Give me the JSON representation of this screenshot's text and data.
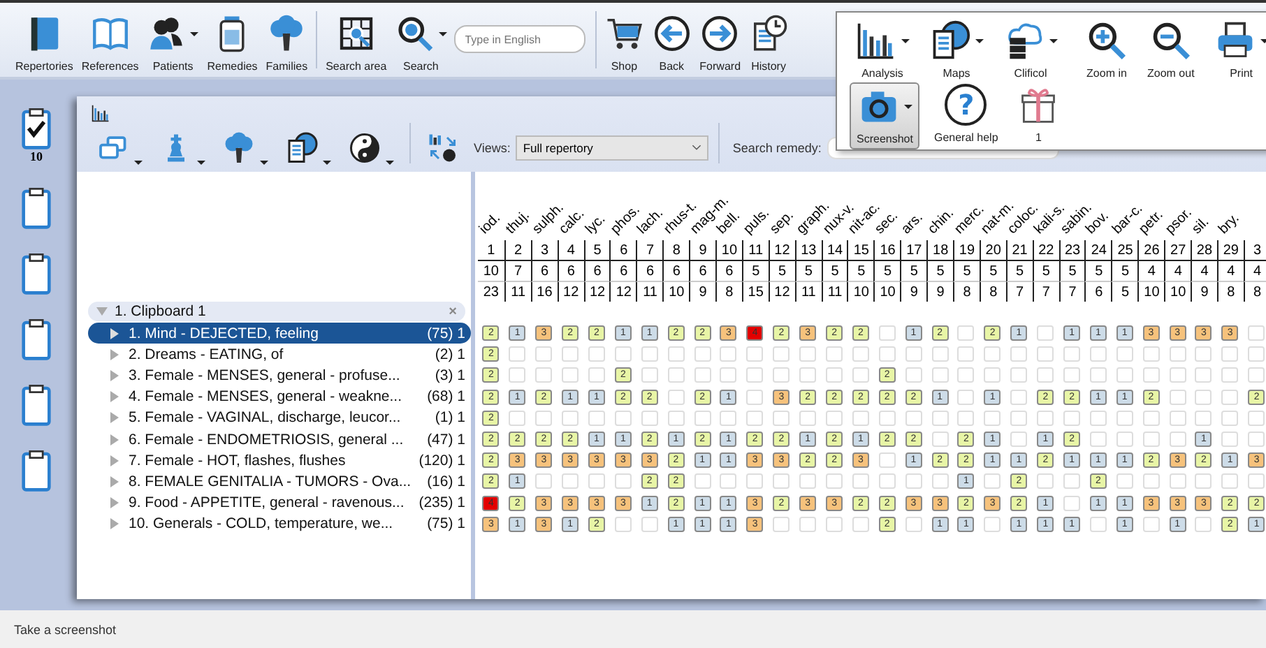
{
  "toolbar": [
    {
      "label": "Repertories",
      "dropdown": false
    },
    {
      "label": "References",
      "dropdown": false
    },
    {
      "label": "Patients",
      "dropdown": true
    },
    {
      "label": "Remedies",
      "dropdown": false
    },
    {
      "label": "Families",
      "dropdown": false
    },
    {
      "label": "Search area",
      "dropdown": false
    },
    {
      "label": "Search",
      "dropdown": true
    },
    {
      "label": "Shop",
      "dropdown": false
    },
    {
      "label": "Back",
      "dropdown": false
    },
    {
      "label": "Forward",
      "dropdown": false
    },
    {
      "label": "History",
      "dropdown": false
    }
  ],
  "search_field": {
    "placeholder": "Type in English"
  },
  "ribbon_menu": {
    "row_1": [
      {
        "label": "Analysis",
        "dropdown": true
      },
      {
        "label": "Maps",
        "dropdown": true
      },
      {
        "label": "Clificol",
        "dropdown": true
      },
      {
        "label": "Zoom in",
        "dropdown": false
      },
      {
        "label": "Zoom out",
        "dropdown": false
      },
      {
        "label": "Print",
        "dropdown": true
      }
    ],
    "row_2": [
      {
        "label": "Screenshot",
        "dropdown": true,
        "selected": true
      },
      {
        "label": "General help",
        "dropdown": false,
        "selected": false,
        "glyph": "?"
      },
      {
        "label": "1",
        "dropdown": false,
        "selected": false
      }
    ]
  },
  "clipboards": [
    {
      "checked": true,
      "count": "10"
    },
    {
      "checked": false
    },
    {
      "checked": false
    },
    {
      "checked": false
    },
    {
      "checked": false
    },
    {
      "checked": false
    }
  ],
  "panel_toolbar": [
    {
      "dropdown": true
    },
    {
      "dropdown": true
    },
    {
      "dropdown": true
    },
    {
      "dropdown": true
    },
    {
      "dropdown": true
    },
    {
      "dropdown": false
    }
  ],
  "views": {
    "label": "Views:",
    "value": "Full repertory"
  },
  "search_remedy": {
    "label": "Search remedy:"
  },
  "remedies": [
    {
      "name": "iod.",
      "number": "1",
      "count": "10",
      "total": "23"
    },
    {
      "name": "thuj.",
      "number": "2",
      "count": "7",
      "total": "11"
    },
    {
      "name": "sulph.",
      "number": "3",
      "count": "6",
      "total": "16"
    },
    {
      "name": "calc.",
      "number": "4",
      "count": "6",
      "total": "12"
    },
    {
      "name": "lyc.",
      "number": "5",
      "count": "6",
      "total": "12"
    },
    {
      "name": "phos.",
      "number": "6",
      "count": "6",
      "total": "12"
    },
    {
      "name": "lach.",
      "number": "7",
      "count": "6",
      "total": "11"
    },
    {
      "name": "rhus-t.",
      "number": "8",
      "count": "6",
      "total": "10"
    },
    {
      "name": "mag-m.",
      "number": "9",
      "count": "6",
      "total": "9"
    },
    {
      "name": "bell.",
      "number": "10",
      "count": "6",
      "total": "8"
    },
    {
      "name": "puls.",
      "number": "11",
      "count": "5",
      "total": "15"
    },
    {
      "name": "sep.",
      "number": "12",
      "count": "5",
      "total": "12"
    },
    {
      "name": "graph.",
      "number": "13",
      "count": "5",
      "total": "11"
    },
    {
      "name": "nux-v.",
      "number": "14",
      "count": "5",
      "total": "11"
    },
    {
      "name": "nit-ac.",
      "number": "15",
      "count": "5",
      "total": "10"
    },
    {
      "name": "sec.",
      "number": "16",
      "count": "5",
      "total": "10"
    },
    {
      "name": "ars.",
      "number": "17",
      "count": "5",
      "total": "9"
    },
    {
      "name": "chin.",
      "number": "18",
      "count": "5",
      "total": "9"
    },
    {
      "name": "merc.",
      "number": "19",
      "count": "5",
      "total": "8"
    },
    {
      "name": "nat-m.",
      "number": "20",
      "count": "5",
      "total": "8"
    },
    {
      "name": "coloc.",
      "number": "21",
      "count": "5",
      "total": "7"
    },
    {
      "name": "kali-s.",
      "number": "22",
      "count": "5",
      "total": "7"
    },
    {
      "name": "sabin.",
      "number": "23",
      "count": "5",
      "total": "7"
    },
    {
      "name": "bov.",
      "number": "24",
      "count": "5",
      "total": "6"
    },
    {
      "name": "bar-c.",
      "number": "25",
      "count": "5",
      "total": "5"
    },
    {
      "name": "petr.",
      "number": "26",
      "count": "4",
      "total": "10"
    },
    {
      "name": "psor.",
      "number": "27",
      "count": "4",
      "total": "10"
    },
    {
      "name": "sil.",
      "number": "28",
      "count": "4",
      "total": "9"
    },
    {
      "name": "bry.",
      "number": "29",
      "count": "4",
      "total": "8"
    },
    {
      "number": "3",
      "count": "4",
      "total": "8"
    }
  ],
  "clipboard": {
    "title": "1. Clipboard 1",
    "expanded": true,
    "close": "×"
  },
  "rubrics": [
    {
      "label": "1. Mind - DEJECTED, feeling",
      "count": "(75) 1",
      "selected": true,
      "cells": [
        {
          "filled": true,
          "grade": "2"
        },
        {
          "filled": true,
          "grade": "1"
        },
        {
          "filled": true,
          "grade": "3"
        },
        {
          "filled": true,
          "grade": "2"
        },
        {
          "filled": true,
          "grade": "2"
        },
        {
          "filled": true,
          "grade": "1"
        },
        {
          "filled": true,
          "grade": "1"
        },
        {
          "filled": true,
          "grade": "2"
        },
        {
          "filled": true,
          "grade": "2"
        },
        {
          "filled": true,
          "grade": "3"
        },
        {
          "filled": true,
          "grade": "4"
        },
        {
          "filled": true,
          "grade": "2"
        },
        {
          "filled": true,
          "grade": "3"
        },
        {
          "filled": true,
          "grade": "2"
        },
        {
          "filled": true,
          "grade": "2"
        },
        {
          "filled": false
        },
        {
          "filled": true,
          "grade": "1"
        },
        {
          "filled": true,
          "grade": "2"
        },
        {
          "filled": false
        },
        {
          "filled": true,
          "grade": "2"
        },
        {
          "filled": true,
          "grade": "1"
        },
        {
          "filled": false
        },
        {
          "filled": true,
          "grade": "1"
        },
        {
          "filled": true,
          "grade": "1"
        },
        {
          "filled": true,
          "grade": "1"
        },
        {
          "filled": true,
          "grade": "3"
        },
        {
          "filled": true,
          "grade": "3"
        },
        {
          "filled": true,
          "grade": "3"
        },
        {
          "filled": true,
          "grade": "3"
        },
        {
          "filled": false
        }
      ]
    },
    {
      "label": "2. Dreams - EATING, of",
      "count": "(2) 1",
      "selected": false,
      "cells": [
        {
          "filled": true,
          "grade": "2"
        },
        {
          "filled": false
        },
        {
          "filled": false
        },
        {
          "filled": false
        },
        {
          "filled": false
        },
        {
          "filled": false
        },
        {
          "filled": false
        },
        {
          "filled": false
        },
        {
          "filled": false
        },
        {
          "filled": false
        },
        {
          "filled": false
        },
        {
          "filled": false
        },
        {
          "filled": false
        },
        {
          "filled": false
        },
        {
          "filled": false
        },
        {
          "filled": false
        },
        {
          "filled": false
        },
        {
          "filled": false
        },
        {
          "filled": false
        },
        {
          "filled": false
        },
        {
          "filled": false
        },
        {
          "filled": false
        },
        {
          "filled": false
        },
        {
          "filled": false
        },
        {
          "filled": false
        },
        {
          "filled": false
        },
        {
          "filled": false
        },
        {
          "filled": false
        },
        {
          "filled": false
        },
        {
          "filled": false
        }
      ]
    },
    {
      "label": "3. Female - MENSES, general - profuse...",
      "count": "(3) 1",
      "selected": false,
      "cells": [
        {
          "filled": true,
          "grade": "2"
        },
        {
          "filled": false
        },
        {
          "filled": false
        },
        {
          "filled": false
        },
        {
          "filled": false
        },
        {
          "filled": true,
          "grade": "2"
        },
        {
          "filled": false
        },
        {
          "filled": false
        },
        {
          "filled": false
        },
        {
          "filled": false
        },
        {
          "filled": false
        },
        {
          "filled": false
        },
        {
          "filled": false
        },
        {
          "filled": false
        },
        {
          "filled": false
        },
        {
          "filled": true,
          "grade": "2"
        },
        {
          "filled": false
        },
        {
          "filled": false
        },
        {
          "filled": false
        },
        {
          "filled": false
        },
        {
          "filled": false
        },
        {
          "filled": false
        },
        {
          "filled": false
        },
        {
          "filled": false
        },
        {
          "filled": false
        },
        {
          "filled": false
        },
        {
          "filled": false
        },
        {
          "filled": false
        },
        {
          "filled": false
        },
        {
          "filled": false
        }
      ]
    },
    {
      "label": "4. Female - MENSES, general - weakne...",
      "count": "(68) 1",
      "selected": false,
      "cells": [
        {
          "filled": true,
          "grade": "2"
        },
        {
          "filled": true,
          "grade": "1"
        },
        {
          "filled": true,
          "grade": "2"
        },
        {
          "filled": true,
          "grade": "1"
        },
        {
          "filled": true,
          "grade": "1"
        },
        {
          "filled": true,
          "grade": "2"
        },
        {
          "filled": true,
          "grade": "2"
        },
        {
          "filled": false
        },
        {
          "filled": true,
          "grade": "2"
        },
        {
          "filled": true,
          "grade": "1"
        },
        {
          "filled": false
        },
        {
          "filled": true,
          "grade": "3"
        },
        {
          "filled": true,
          "grade": "2"
        },
        {
          "filled": true,
          "grade": "2"
        },
        {
          "filled": true,
          "grade": "2"
        },
        {
          "filled": true,
          "grade": "2"
        },
        {
          "filled": true,
          "grade": "2"
        },
        {
          "filled": true,
          "grade": "1"
        },
        {
          "filled": false
        },
        {
          "filled": true,
          "grade": "1"
        },
        {
          "filled": false
        },
        {
          "filled": true,
          "grade": "2"
        },
        {
          "filled": true,
          "grade": "2"
        },
        {
          "filled": true,
          "grade": "1"
        },
        {
          "filled": true,
          "grade": "1"
        },
        {
          "filled": true,
          "grade": "2"
        },
        {
          "filled": false
        },
        {
          "filled": false
        },
        {
          "filled": false
        },
        {
          "filled": true,
          "grade": "2"
        }
      ]
    },
    {
      "label": "5. Female - VAGINAL, discharge, leucor...",
      "count": "(1) 1",
      "selected": false,
      "cells": [
        {
          "filled": true,
          "grade": "2"
        },
        {
          "filled": false
        },
        {
          "filled": false
        },
        {
          "filled": false
        },
        {
          "filled": false
        },
        {
          "filled": false
        },
        {
          "filled": false
        },
        {
          "filled": false
        },
        {
          "filled": false
        },
        {
          "filled": false
        },
        {
          "filled": false
        },
        {
          "filled": false
        },
        {
          "filled": false
        },
        {
          "filled": false
        },
        {
          "filled": false
        },
        {
          "filled": false
        },
        {
          "filled": false
        },
        {
          "filled": false
        },
        {
          "filled": false
        },
        {
          "filled": false
        },
        {
          "filled": false
        },
        {
          "filled": false
        },
        {
          "filled": false
        },
        {
          "filled": false
        },
        {
          "filled": false
        },
        {
          "filled": false
        },
        {
          "filled": false
        },
        {
          "filled": false
        },
        {
          "filled": false
        },
        {
          "filled": false
        }
      ]
    },
    {
      "label": "6. Female - ENDOMETRIOSIS, general ...",
      "count": "(47) 1",
      "selected": false,
      "cells": [
        {
          "filled": true,
          "grade": "2"
        },
        {
          "filled": true,
          "grade": "2"
        },
        {
          "filled": true,
          "grade": "2"
        },
        {
          "filled": true,
          "grade": "2"
        },
        {
          "filled": true,
          "grade": "1"
        },
        {
          "filled": true,
          "grade": "1"
        },
        {
          "filled": true,
          "grade": "2"
        },
        {
          "filled": true,
          "grade": "1"
        },
        {
          "filled": true,
          "grade": "2"
        },
        {
          "filled": true,
          "grade": "1"
        },
        {
          "filled": true,
          "grade": "2"
        },
        {
          "filled": true,
          "grade": "2"
        },
        {
          "filled": true,
          "grade": "1"
        },
        {
          "filled": true,
          "grade": "2"
        },
        {
          "filled": true,
          "grade": "1"
        },
        {
          "filled": true,
          "grade": "2"
        },
        {
          "filled": true,
          "grade": "2"
        },
        {
          "filled": false
        },
        {
          "filled": true,
          "grade": "2"
        },
        {
          "filled": true,
          "grade": "1"
        },
        {
          "filled": false
        },
        {
          "filled": true,
          "grade": "1"
        },
        {
          "filled": true,
          "grade": "2"
        },
        {
          "filled": false
        },
        {
          "filled": false
        },
        {
          "filled": false
        },
        {
          "filled": false
        },
        {
          "filled": true,
          "grade": "1"
        },
        {
          "filled": false
        },
        {
          "filled": false
        }
      ]
    },
    {
      "label": "7. Female - HOT, flashes, flushes",
      "count": "(120) 1",
      "selected": false,
      "cells": [
        {
          "filled": true,
          "grade": "2"
        },
        {
          "filled": true,
          "grade": "3"
        },
        {
          "filled": true,
          "grade": "3"
        },
        {
          "filled": true,
          "grade": "3"
        },
        {
          "filled": true,
          "grade": "3"
        },
        {
          "filled": true,
          "grade": "3"
        },
        {
          "filled": true,
          "grade": "3"
        },
        {
          "filled": true,
          "grade": "2"
        },
        {
          "filled": true,
          "grade": "1"
        },
        {
          "filled": true,
          "grade": "1"
        },
        {
          "filled": true,
          "grade": "3"
        },
        {
          "filled": true,
          "grade": "3"
        },
        {
          "filled": true,
          "grade": "2"
        },
        {
          "filled": true,
          "grade": "2"
        },
        {
          "filled": true,
          "grade": "3"
        },
        {
          "filled": false
        },
        {
          "filled": true,
          "grade": "1"
        },
        {
          "filled": true,
          "grade": "2"
        },
        {
          "filled": true,
          "grade": "2"
        },
        {
          "filled": true,
          "grade": "1"
        },
        {
          "filled": true,
          "grade": "1"
        },
        {
          "filled": true,
          "grade": "2"
        },
        {
          "filled": true,
          "grade": "1"
        },
        {
          "filled": true,
          "grade": "1"
        },
        {
          "filled": true,
          "grade": "1"
        },
        {
          "filled": true,
          "grade": "2"
        },
        {
          "filled": true,
          "grade": "3"
        },
        {
          "filled": true,
          "grade": "2"
        },
        {
          "filled": true,
          "grade": "1"
        },
        {
          "filled": true,
          "grade": "3"
        }
      ]
    },
    {
      "label": "8. FEMALE GENITALIA - TUMORS - Ova...",
      "count": "(16) 1",
      "selected": false,
      "cells": [
        {
          "filled": true,
          "grade": "2"
        },
        {
          "filled": true,
          "grade": "1"
        },
        {
          "filled": false
        },
        {
          "filled": false
        },
        {
          "filled": false
        },
        {
          "filled": false
        },
        {
          "filled": true,
          "grade": "2"
        },
        {
          "filled": true,
          "grade": "2"
        },
        {
          "filled": false
        },
        {
          "filled": false
        },
        {
          "filled": false
        },
        {
          "filled": false
        },
        {
          "filled": false
        },
        {
          "filled": false
        },
        {
          "filled": false
        },
        {
          "filled": false
        },
        {
          "filled": false
        },
        {
          "filled": false
        },
        {
          "filled": true,
          "grade": "1"
        },
        {
          "filled": false
        },
        {
          "filled": true,
          "grade": "2"
        },
        {
          "filled": false
        },
        {
          "filled": false
        },
        {
          "filled": true,
          "grade": "2"
        },
        {
          "filled": false
        },
        {
          "filled": false
        },
        {
          "filled": false
        },
        {
          "filled": false
        },
        {
          "filled": false
        },
        {
          "filled": false
        }
      ]
    },
    {
      "label": "9. Food - APPETITE, general - ravenous...",
      "count": "(235) 1",
      "selected": false,
      "cells": [
        {
          "filled": true,
          "grade": "4"
        },
        {
          "filled": true,
          "grade": "2"
        },
        {
          "filled": true,
          "grade": "3"
        },
        {
          "filled": true,
          "grade": "3"
        },
        {
          "filled": true,
          "grade": "3"
        },
        {
          "filled": true,
          "grade": "3"
        },
        {
          "filled": true,
          "grade": "1"
        },
        {
          "filled": true,
          "grade": "2"
        },
        {
          "filled": true,
          "grade": "1"
        },
        {
          "filled": true,
          "grade": "1"
        },
        {
          "filled": true,
          "grade": "3"
        },
        {
          "filled": true,
          "grade": "2"
        },
        {
          "filled": true,
          "grade": "3"
        },
        {
          "filled": true,
          "grade": "3"
        },
        {
          "filled": true,
          "grade": "2"
        },
        {
          "filled": true,
          "grade": "2"
        },
        {
          "filled": true,
          "grade": "3"
        },
        {
          "filled": true,
          "grade": "3"
        },
        {
          "filled": true,
          "grade": "2"
        },
        {
          "filled": true,
          "grade": "3"
        },
        {
          "filled": true,
          "grade": "2"
        },
        {
          "filled": true,
          "grade": "1"
        },
        {
          "filled": false
        },
        {
          "filled": true,
          "grade": "1"
        },
        {
          "filled": true,
          "grade": "1"
        },
        {
          "filled": true,
          "grade": "3"
        },
        {
          "filled": true,
          "grade": "3"
        },
        {
          "filled": true,
          "grade": "3"
        },
        {
          "filled": true,
          "grade": "2"
        },
        {
          "filled": true,
          "grade": "2"
        }
      ]
    },
    {
      "label": "10. Generals - COLD, temperature, we...",
      "count": "(75) 1",
      "selected": false,
      "cells": [
        {
          "filled": true,
          "grade": "3"
        },
        {
          "filled": true,
          "grade": "1"
        },
        {
          "filled": true,
          "grade": "3"
        },
        {
          "filled": true,
          "grade": "1"
        },
        {
          "filled": true,
          "grade": "2"
        },
        {
          "filled": false
        },
        {
          "filled": false
        },
        {
          "filled": true,
          "grade": "1"
        },
        {
          "filled": true,
          "grade": "1"
        },
        {
          "filled": true,
          "grade": "1"
        },
        {
          "filled": true,
          "grade": "3"
        },
        {
          "filled": false
        },
        {
          "filled": false
        },
        {
          "filled": false
        },
        {
          "filled": false
        },
        {
          "filled": true,
          "grade": "2"
        },
        {
          "filled": false
        },
        {
          "filled": true,
          "grade": "1"
        },
        {
          "filled": true,
          "grade": "1"
        },
        {
          "filled": false
        },
        {
          "filled": true,
          "grade": "1"
        },
        {
          "filled": true,
          "grade": "1"
        },
        {
          "filled": true,
          "grade": "1"
        },
        {
          "filled": false
        },
        {
          "filled": true,
          "grade": "1"
        },
        {
          "filled": false
        },
        {
          "filled": true,
          "grade": "1"
        },
        {
          "filled": false
        },
        {
          "filled": true,
          "grade": "2"
        },
        {
          "filled": true,
          "grade": "1"
        }
      ]
    }
  ],
  "status_bar": "Take a screenshot"
}
